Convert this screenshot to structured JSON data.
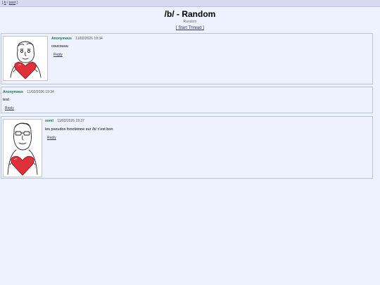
{
  "nav": {
    "link1": "b",
    "sep": "/",
    "link2": "post"
  },
  "board": {
    "title": "/b/ - Random",
    "subtitle": "Random",
    "start_thread": "[ Start Thread ]"
  },
  "posts": [
    {
      "name": "Anonymous",
      "date": "11/02/2026 19:34",
      "message": "coucouuu",
      "reply": "Reply",
      "image_icon": "cartoon-man-holding-heart"
    },
    {
      "name": "Anonymous",
      "date": "11/02/2026 19:34",
      "message": "test",
      "reply": "Reply"
    },
    {
      "name": "sorel",
      "date": "11/02/2026 19:37",
      "message": "les pseudos fonctionne sur /b/ c'est bon",
      "reply": "Reply",
      "image_icon": "cartoon-man-holding-heart"
    }
  ],
  "colors": {
    "background": "#eef2ff",
    "border": "#b7c5d9",
    "name": "#117743",
    "link": "#34345c",
    "heart": "#e0313a"
  }
}
